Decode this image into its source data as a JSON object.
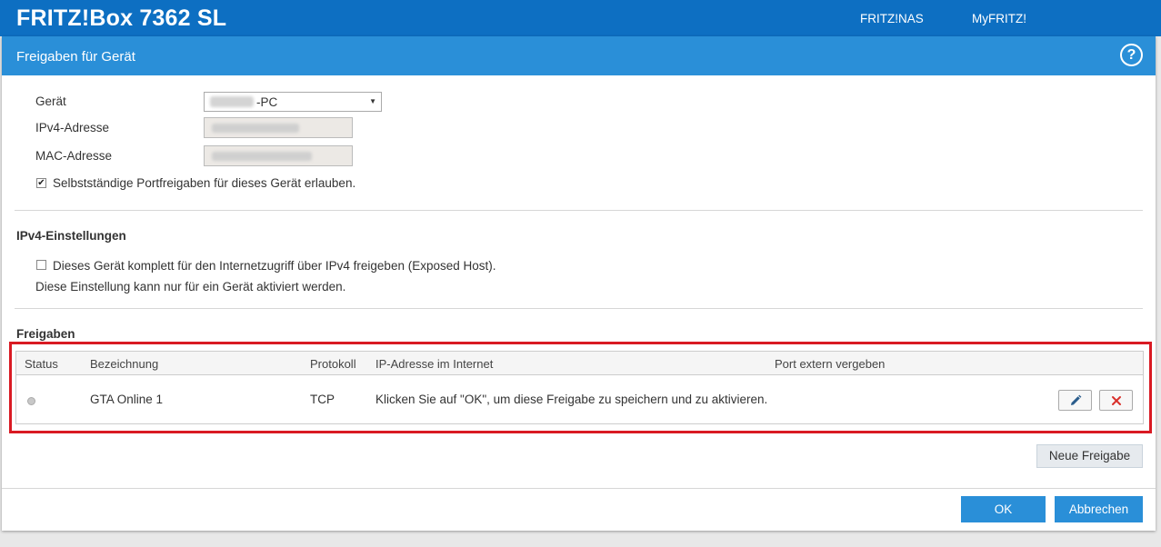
{
  "topbar": {
    "brand": "FRITZ!Box 7362 SL",
    "links": [
      "FRITZ!NAS",
      "MyFRITZ!"
    ]
  },
  "dialog": {
    "title": "Freigaben für Gerät",
    "help_label": "?",
    "device": {
      "geraet_label": "Gerät",
      "geraet_value": "-PC",
      "ipv4_label": "IPv4-Adresse",
      "mac_label": "MAC-Adresse",
      "selfshare_label": "Selbstständige Portfreigaben für dieses Gerät erlauben.",
      "selfshare_checked": true
    },
    "ipv4": {
      "title": "IPv4-Einstellungen",
      "exposed_label": "Dieses Gerät komplett für den Internetzugriff über IPv4 freigeben (Exposed Host).",
      "exposed_checked": false,
      "note": "Diese Einstellung kann nur für ein Gerät aktiviert werden."
    },
    "freigaben": {
      "title": "Freigaben",
      "columns": [
        "Status",
        "Bezeichnung",
        "Protokoll",
        "IP-Adresse im Internet",
        "Port extern vergeben"
      ],
      "rows": [
        {
          "name": "GTA Online 1",
          "protocol": "TCP",
          "info": "Klicken Sie auf \"OK\", um diese Freigabe zu speichern und zu aktivieren."
        }
      ],
      "new_button": "Neue Freigabe"
    },
    "ok_button": "OK",
    "cancel_button": "Abbrechen"
  },
  "colors": {
    "topbar": "#0d6fc2",
    "header": "#2a8fd8",
    "highlight": "#d91a23",
    "delete_icon": "#d9302b",
    "edit_icon": "#2a5d8c"
  },
  "icons": [
    "help-icon",
    "dropdown-arrow-icon",
    "checkbox-checked-icon",
    "checkbox-empty-icon",
    "status-inactive-icon",
    "pencil-icon",
    "close-icon"
  ]
}
